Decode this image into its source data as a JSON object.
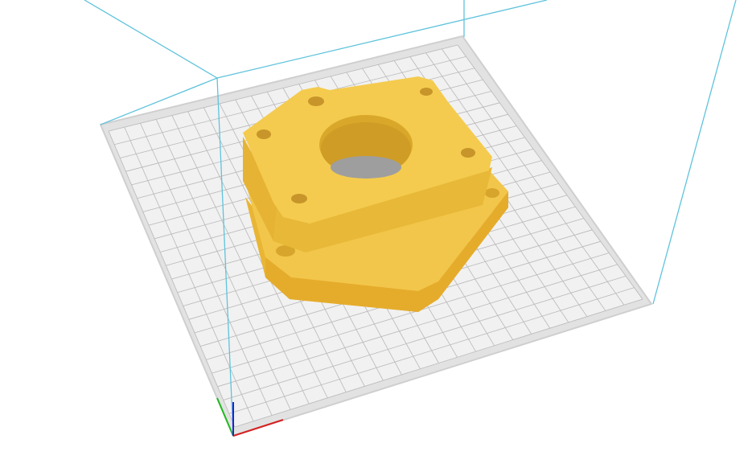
{
  "viewport": {
    "background": "#ffffff",
    "build_volume_color": "#5fc3dc",
    "plate_color": "#e4e4e4",
    "plate_grid_color": "#b8b8b8",
    "plate_border_color": "#c9c9c9",
    "model_colors": {
      "top": "#f3c94a",
      "side_light": "#eab93a",
      "side_dark": "#e2ad2c",
      "hole_inner": "#9b9b9b",
      "hole_rim": "#d9a82a"
    },
    "axis_colors": {
      "x": "#d62222",
      "y": "#22b922",
      "z": "#2222d6"
    },
    "objects": [
      {
        "name": "bracket-model",
        "icon": "3d-part"
      }
    ]
  }
}
